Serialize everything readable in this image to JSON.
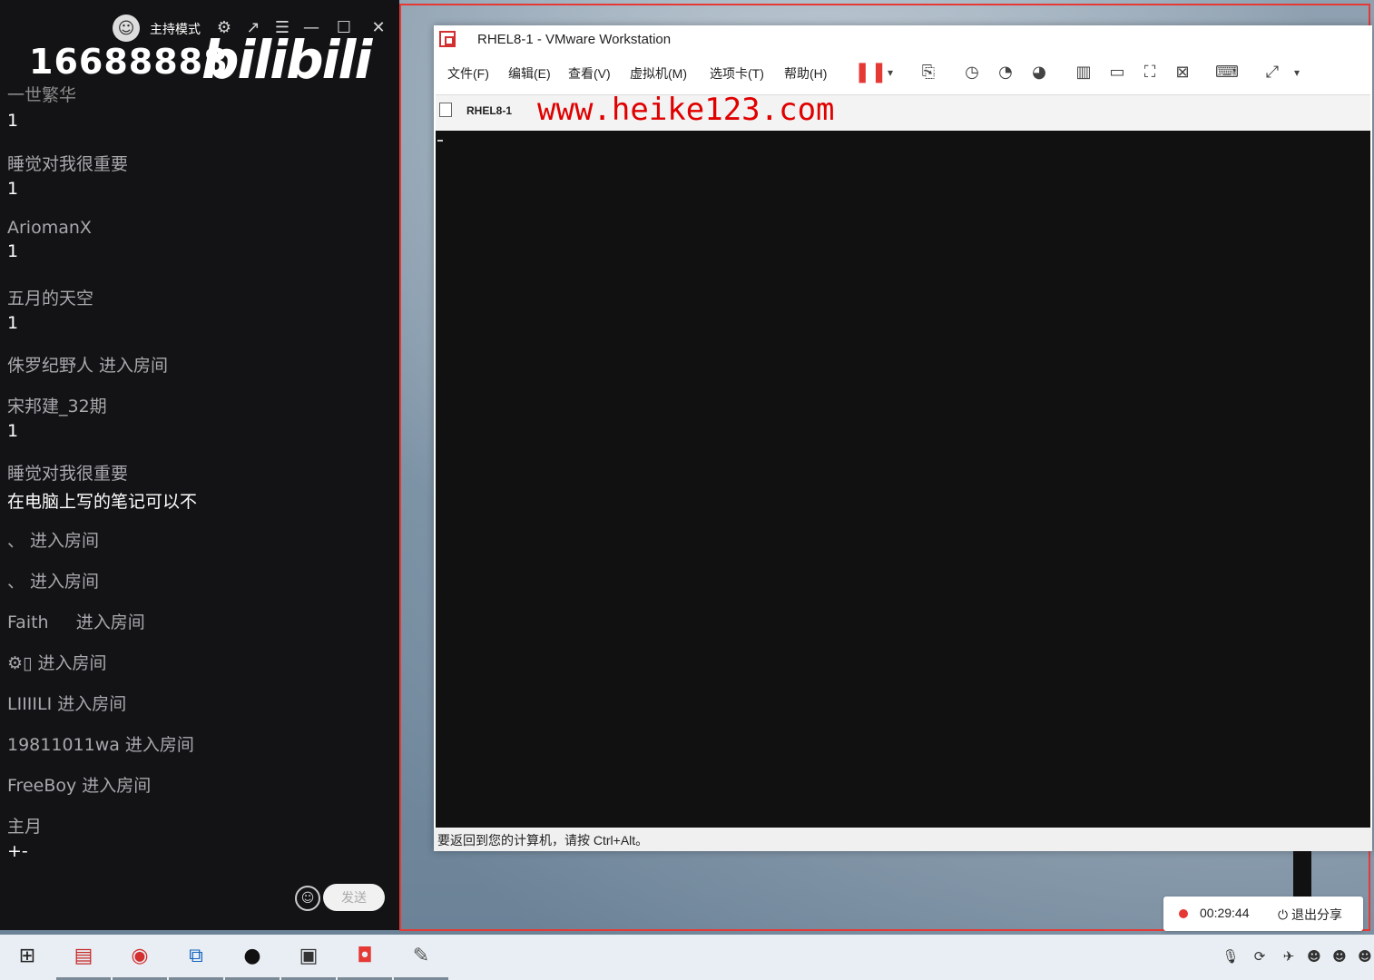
{
  "chat_panel": {
    "host_mode_label": "主持模式",
    "room_id": "16688888",
    "logo_text": "bilibili",
    "partial_top_user": "一世繁华",
    "messages": [
      {
        "user": "",
        "text": "1"
      },
      {
        "user": "睡觉对我很重要",
        "text": "1"
      },
      {
        "user": "AriomanX",
        "text": "1"
      },
      {
        "user": "五月的天空",
        "text": "1"
      },
      {
        "user": "侏罗纪野人 进入房间",
        "text": ""
      },
      {
        "user": "宋邦建_32期",
        "text": "1"
      },
      {
        "user": "睡觉对我很重要",
        "text": "在电脑上写的笔记可以不"
      },
      {
        "user": "、 进入房间",
        "text": ""
      },
      {
        "user": "、 进入房间",
        "text": ""
      },
      {
        "user": "Faith     进入房间",
        "text": ""
      },
      {
        "user": "⚙▯ 进入房间",
        "text": ""
      },
      {
        "user": "LIIIILI 进入房间",
        "text": ""
      },
      {
        "user": "19811011wa 进入房间",
        "text": ""
      },
      {
        "user": "FreeBoy 进入房间",
        "text": ""
      },
      {
        "user": "主月",
        "text": "+-"
      }
    ],
    "send_label": "发送",
    "icons": [
      "settings-icon",
      "popout-icon",
      "menu-icon",
      "minimize-icon",
      "maximize-icon",
      "close-icon",
      "emoji-icon"
    ]
  },
  "vmware": {
    "title": "RHEL8-1 - VMware Workstation",
    "menus": [
      "文件(F)",
      "编辑(E)",
      "查看(V)",
      "虚拟机(M)",
      "选项卡(T)",
      "帮助(H)"
    ],
    "tab_label": "RHEL8-1",
    "watermark": "www.heike123.com",
    "status_text": "要返回到您的计算机，请按 Ctrl+Alt。"
  },
  "share_control": {
    "time": "00:29:44",
    "exit_label": "退出分享"
  },
  "colors": {
    "accent_red": "#e53935",
    "chat_bg": "#131214"
  }
}
